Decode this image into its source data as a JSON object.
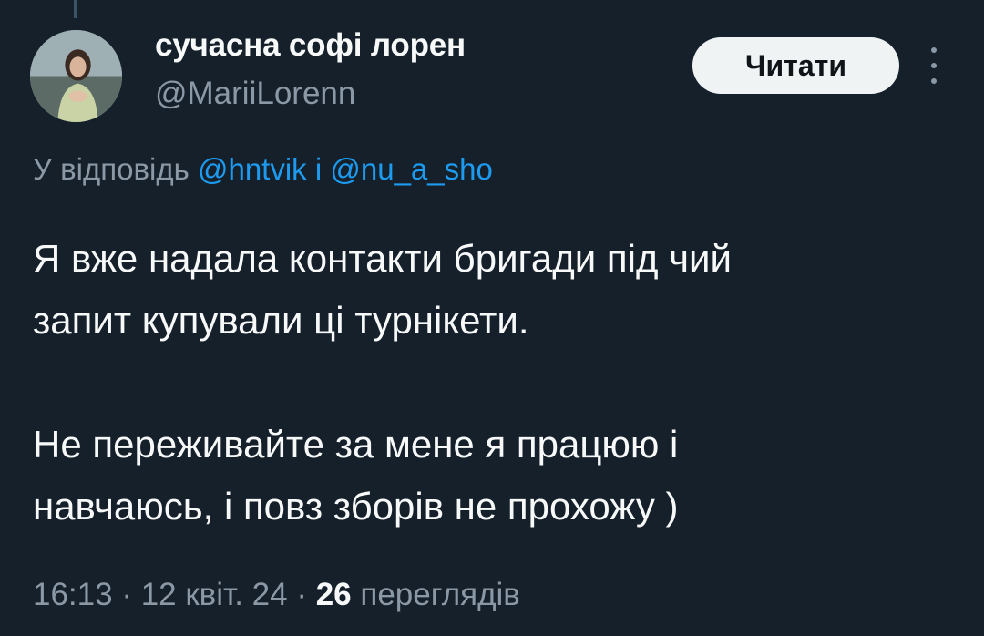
{
  "author": {
    "display_name": "сучасна софі лорен",
    "handle": "@MariiLorenn"
  },
  "follow_button_label": "Читати",
  "more_icon": "more-vertical-icon",
  "reply": {
    "prefix": "У відповідь",
    "mentions": [
      "@hntvik",
      "@nu_a_sho"
    ],
    "separator": "і"
  },
  "tweet": {
    "lines": [
      "Я вже надала контакти бригади під чий",
      "запит купували ці турнікети.",
      "",
      "Не переживайте за мене я працюю і",
      "навчаюсь, і повз зборів не прохожу )"
    ]
  },
  "meta": {
    "time": "16:13",
    "date": "12 квіт. 24",
    "dot": "·",
    "views_count": "26",
    "views_label": "переглядів"
  },
  "colors": {
    "background": "#15202b",
    "text": "#f7f9f9",
    "muted": "#8b98a5",
    "link": "#1d9bf0",
    "button_bg": "#eff3f4"
  }
}
